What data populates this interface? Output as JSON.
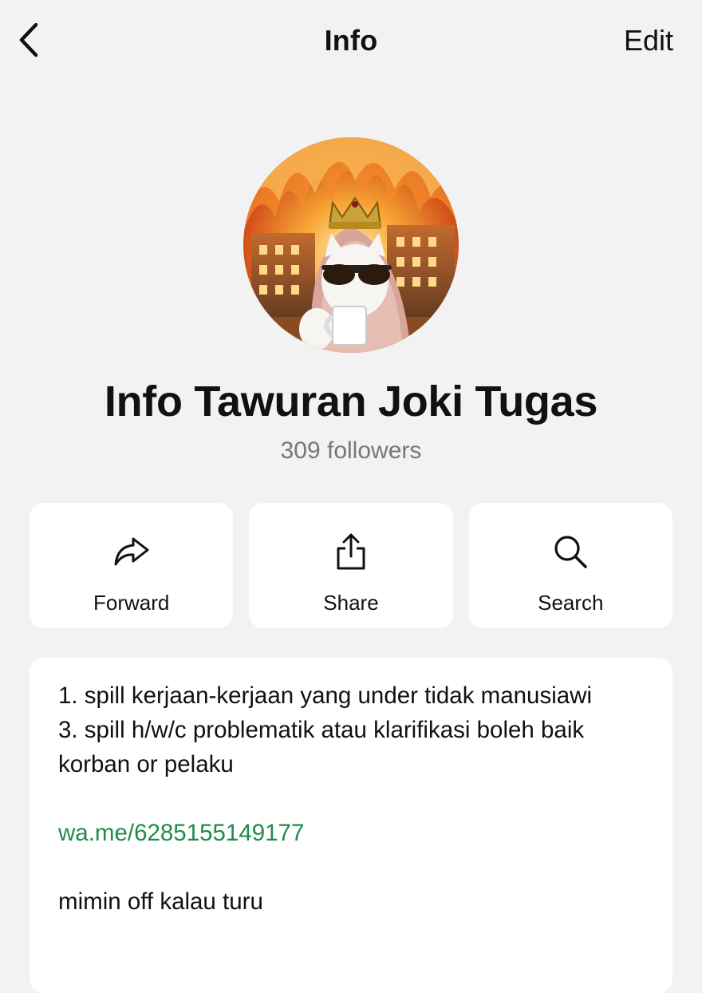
{
  "nav": {
    "back_icon": "chevron-left-icon",
    "title": "Info",
    "edit_label": "Edit"
  },
  "channel": {
    "name": "Info Tawuran Joki Tugas",
    "followers": "309 followers"
  },
  "actions": [
    {
      "icon": "forward-icon",
      "label": "Forward"
    },
    {
      "icon": "share-icon",
      "label": "Share"
    },
    {
      "icon": "search-icon",
      "label": "Search"
    }
  ],
  "description": {
    "line1": "1. spill kerjaan-kerjaan yang under tidak manusiawi",
    "line2": "3. spill h/w/c problematik atau klarifikasi boleh baik korban or pelaku",
    "link": "wa.me/6285155149177",
    "line3": "mimin off kalau turu"
  },
  "colors": {
    "background": "#f2f2f2",
    "card": "#ffffff",
    "link": "#1f8a4c",
    "secondary_text": "#777777"
  }
}
